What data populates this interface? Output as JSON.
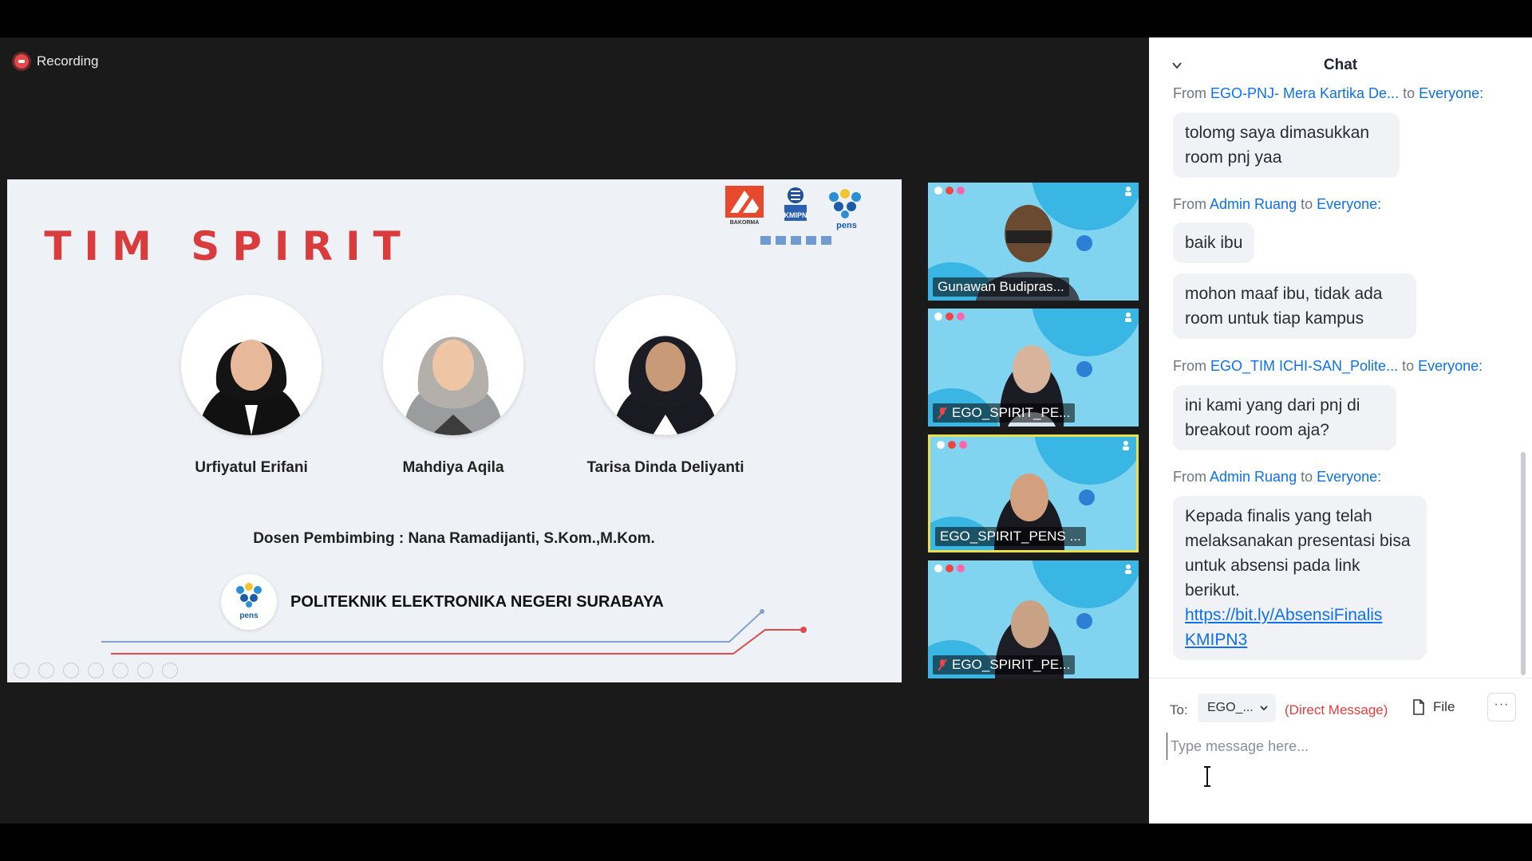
{
  "recording": {
    "label": "Recording"
  },
  "slide": {
    "title": "TIM SPIRIT",
    "logos": {
      "bakorma": "BAKORMA",
      "kmipn": "KMIPN",
      "pens": "pens"
    },
    "members": [
      {
        "name": "Urfiyatul Erifani"
      },
      {
        "name": "Mahdiya Aqila"
      },
      {
        "name": "Tarisa Dinda Deliyanti"
      }
    ],
    "supervisor": "Dosen Pembimbing : Nana Ramadijanti, S.Kom.,M.Kom.",
    "institution": "POLITEKNIK ELEKTRONIKA NEGERI SURABAYA",
    "institution_logo_text": "pens"
  },
  "participants": [
    {
      "name": "Gunawan Budipras...",
      "muted": false,
      "active": false
    },
    {
      "name": "EGO_SPIRIT_PE...",
      "muted": true,
      "active": false
    },
    {
      "name": "EGO_SPIRIT_PENS ...",
      "muted": false,
      "active": true
    },
    {
      "name": "EGO_SPIRIT_PE...",
      "muted": true,
      "active": false
    }
  ],
  "chat": {
    "title": "Chat",
    "to_word": "to",
    "messages": [
      {
        "from_prefix": "From",
        "sender": "EGO-PNJ- Mera Kartika De...",
        "recipient": "Everyone:",
        "texts": [
          "tolomg saya dimasukkan room pnj yaa"
        ]
      },
      {
        "from_prefix": "From",
        "sender": "Admin Ruang",
        "recipient": "Everyone:",
        "texts": [
          "baik ibu",
          "mohon maaf ibu, tidak ada room untuk tiap kampus"
        ]
      },
      {
        "from_prefix": "From",
        "sender": "EGO_TIM ICHI-SAN_Polite...",
        "recipient": "Everyone:",
        "texts": [
          "ini kami yang dari pnj di breakout room aja?"
        ]
      },
      {
        "from_prefix": "From",
        "sender": "Admin Ruang",
        "recipient": "Everyone:",
        "texts": [
          "Kepada finalis yang telah melaksanakan presentasi bisa untuk absensi pada link berikut."
        ],
        "link": "https://bit.ly/AbsensiFinalisKMIPN3",
        "link_line1": "https://bit.ly/AbsensiFinalis",
        "link_line2": "KMIPN3"
      }
    ],
    "composer": {
      "to_label": "To:",
      "recipient_value": "EGO_...",
      "direct_message": "(Direct Message)",
      "file_label": "File",
      "more_label": "···",
      "placeholder": "Type message here..."
    }
  },
  "colors": {
    "accent": "#0e71eb",
    "title_red": "#d93c3c",
    "active_border": "#e9e14a",
    "direct_red": "#e03e3e"
  }
}
